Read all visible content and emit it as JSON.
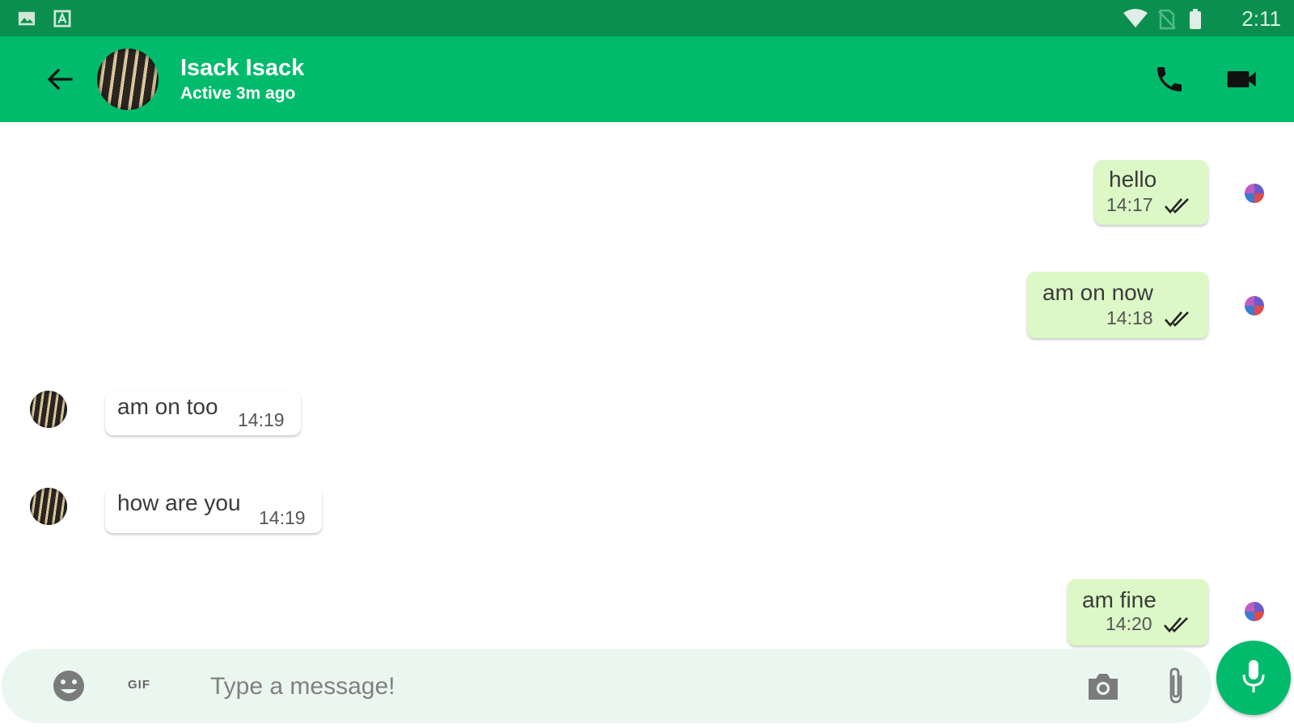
{
  "status_bar": {
    "time": "2:11",
    "left_icons": [
      "gallery-icon",
      "text-icon"
    ],
    "right_icons": [
      "wifi-icon",
      "no-sim-icon",
      "battery-icon"
    ],
    "background": "#0a8f4f"
  },
  "header": {
    "contact_name": "Isack Isack",
    "contact_status": "Active 3m ago",
    "background": "#00bb6c",
    "icons": [
      "arrow-back-icon",
      "phone-icon",
      "video-camera-icon"
    ]
  },
  "messages": [
    {
      "direction": "outgoing",
      "text": "hello",
      "time": "14:17",
      "status": "read"
    },
    {
      "direction": "outgoing",
      "text": "am on now",
      "time": "14:18",
      "status": "read"
    },
    {
      "direction": "incoming",
      "text": "am on too",
      "time": "14:19"
    },
    {
      "direction": "incoming",
      "text": "how are you",
      "time": "14:19"
    },
    {
      "direction": "outgoing",
      "text": "am fine",
      "time": "14:20",
      "status": "read"
    }
  ],
  "composer": {
    "placeholder": "Type a message!",
    "value": "",
    "gif_label": "GIF",
    "icons": [
      "emoji-icon",
      "camera-icon",
      "attachment-icon",
      "microphone-icon"
    ]
  },
  "colors": {
    "outgoing_bubble": "#dcf8c6",
    "incoming_bubble": "#ffffff",
    "composer_background": "#eaf7f0",
    "accent": "#00bb6c"
  }
}
